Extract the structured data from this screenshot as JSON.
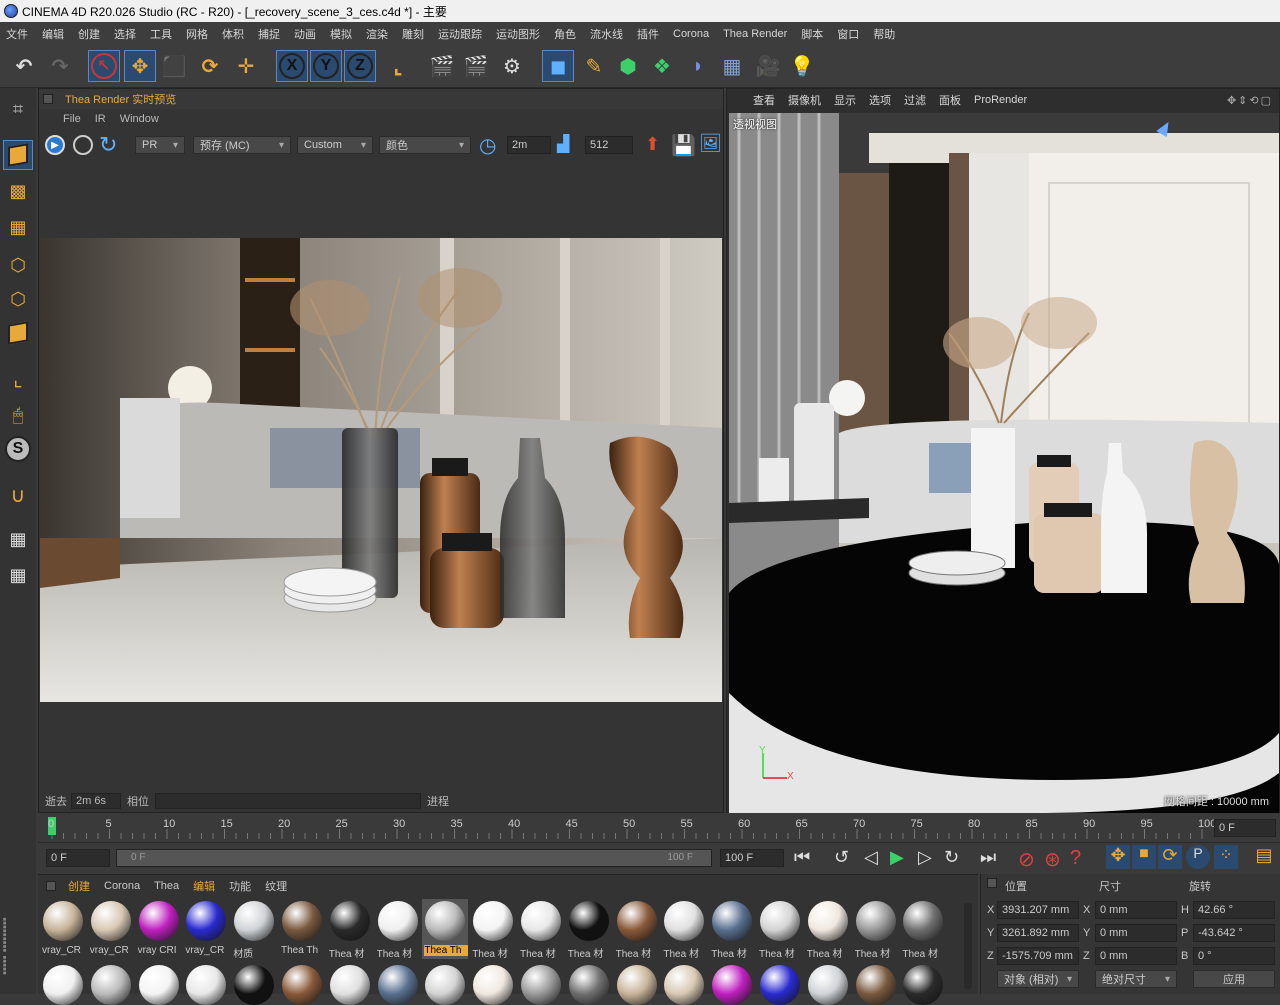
{
  "window": {
    "title": "CINEMA 4D R20.026 Studio (RC - R20) - [_recovery_scene_3_ces.c4d *] - 主要"
  },
  "menubar": {
    "items": [
      "文件",
      "编辑",
      "创建",
      "选择",
      "工具",
      "网格",
      "体积",
      "捕捉",
      "动画",
      "模拟",
      "渲染",
      "雕刻",
      "运动跟踪",
      "运动图形",
      "角色",
      "流水线",
      "插件",
      "Corona",
      "Thea Render",
      "脚本",
      "窗口",
      "帮助"
    ]
  },
  "toolbar": {
    "x_label": "X",
    "y_label": "Y",
    "z_label": "Z"
  },
  "thea": {
    "title": "Thea Render 实时预览",
    "menu": [
      "File",
      "IR",
      "Window"
    ],
    "dropdown_mode": "PR",
    "dropdown_preset": "预存 (MC)",
    "dropdown_custom": "Custom",
    "dropdown_channel": "颜色",
    "time_value": "2m",
    "samples_value": "512",
    "status_elapsed_label": "逝去",
    "status_elapsed_value": "2m 6s",
    "status_phase_label": "相位",
    "status_progress_label": "进程"
  },
  "viewport": {
    "menu": [
      "查看",
      "摄像机",
      "显示",
      "选项",
      "过滤",
      "面板",
      "ProRender"
    ],
    "label": "透视视图",
    "grid_info": "网格间距 : 10000 mm",
    "axis_y": "Y",
    "axis_x": "X"
  },
  "timeline": {
    "ticks": [
      "0",
      "5",
      "10",
      "15",
      "20",
      "25",
      "30",
      "35",
      "40",
      "45",
      "50",
      "55",
      "60",
      "65",
      "70",
      "75",
      "80",
      "85",
      "90",
      "95",
      "100"
    ],
    "current_frame": "0 F"
  },
  "transport": {
    "start_field": "0 F",
    "range_start": "0 F",
    "range_end": "100 F",
    "end_field": "100 F"
  },
  "materials": {
    "tabs": [
      "创建",
      "Corona",
      "Thea",
      "编辑",
      "功能",
      "纹理"
    ],
    "items": [
      {
        "label": "vray_CR",
        "color": "#c8b49a"
      },
      {
        "label": "vray_CR",
        "color": "#d8c8b4"
      },
      {
        "label": "vray CRI",
        "color": "#c020c0"
      },
      {
        "label": "vray_CR",
        "color": "#2a2ad0"
      },
      {
        "label": "材质",
        "color": "#d0d4d8"
      },
      {
        "label": "Thea Th",
        "color": "#7a5a40"
      },
      {
        "label": "Thea 材",
        "color": "#2a2a2a"
      },
      {
        "label": "Thea 材",
        "color": "#f0f0f0"
      },
      {
        "label": "Thea Th",
        "color": "#bbbbbb"
      },
      {
        "label": "Thea 材",
        "color": "#f4f4f4"
      },
      {
        "label": "Thea 材",
        "color": "#e8e8e8"
      },
      {
        "label": "Thea 材",
        "color": "#111111"
      },
      {
        "label": "Thea 材",
        "color": "#8a5a3a"
      },
      {
        "label": "Thea 材",
        "color": "#e0e0e0"
      },
      {
        "label": "Thea 材",
        "color": "#5a7090"
      },
      {
        "label": "Thea 材",
        "color": "#d4d4d4"
      },
      {
        "label": "Thea 材",
        "color": "#efe8e0"
      },
      {
        "label": "Thea 材",
        "color": "#9a9a9a"
      },
      {
        "label": "Thea 材",
        "color": "#707070"
      }
    ],
    "selected_index": 8
  },
  "coords": {
    "headers": [
      "位置",
      "尺寸",
      "旋转"
    ],
    "pos": [
      {
        "axis": "X",
        "value": "3931.207 mm"
      },
      {
        "axis": "Y",
        "value": "3261.892 mm"
      },
      {
        "axis": "Z",
        "value": "-1575.709 mm"
      }
    ],
    "size": [
      {
        "axis": "X",
        "value": "0 mm"
      },
      {
        "axis": "Y",
        "value": "0 mm"
      },
      {
        "axis": "Z",
        "value": "0 mm"
      }
    ],
    "rot": [
      {
        "axis": "H",
        "value": "42.66 °"
      },
      {
        "axis": "P",
        "value": "-43.642 °"
      },
      {
        "axis": "B",
        "value": "0 °"
      }
    ],
    "mode_dropdown": "对象 (相对)",
    "size_dropdown": "绝对尺寸",
    "apply_button": "应用"
  }
}
